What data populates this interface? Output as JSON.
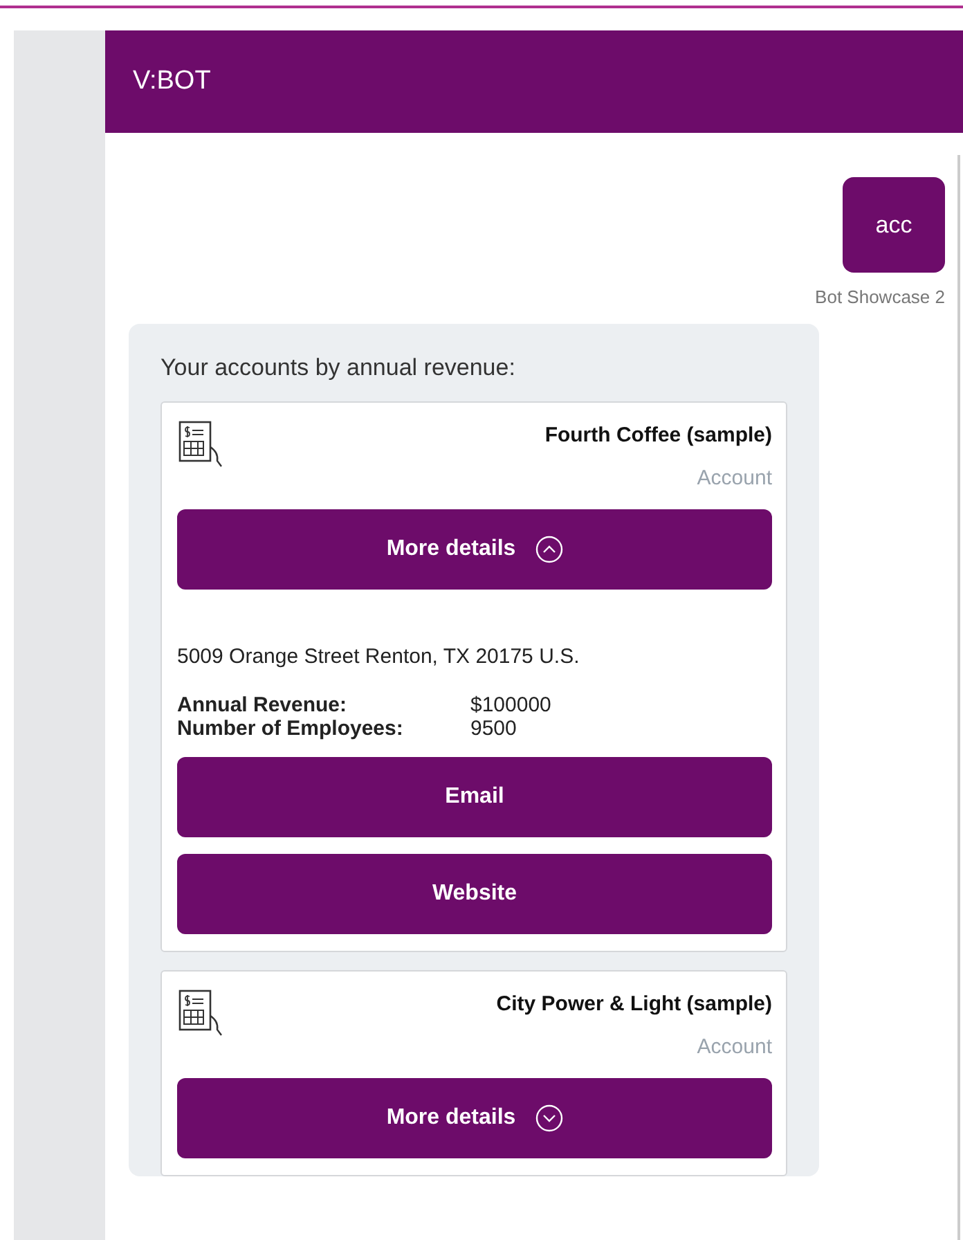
{
  "header": {
    "title": "V:BOT"
  },
  "user_message": {
    "text": "acc",
    "sender": "Bot Showcase 2"
  },
  "bot_message": {
    "text": "Your accounts by annual revenue:",
    "cards": [
      {
        "name": "Fourth Coffee (sample)",
        "type": "Account",
        "button": "More details",
        "expanded": true,
        "address": "5009 Orange Street Renton, TX 20175 U.S.",
        "facts": [
          {
            "label": "Annual Revenue:",
            "value": "$100000"
          },
          {
            "label": "Number of Employees:",
            "value": "9500"
          }
        ],
        "actions": [
          "Email",
          "Website"
        ]
      },
      {
        "name": "City Power & Light (sample)",
        "type": "Account",
        "button": "More details",
        "expanded": false
      }
    ]
  }
}
